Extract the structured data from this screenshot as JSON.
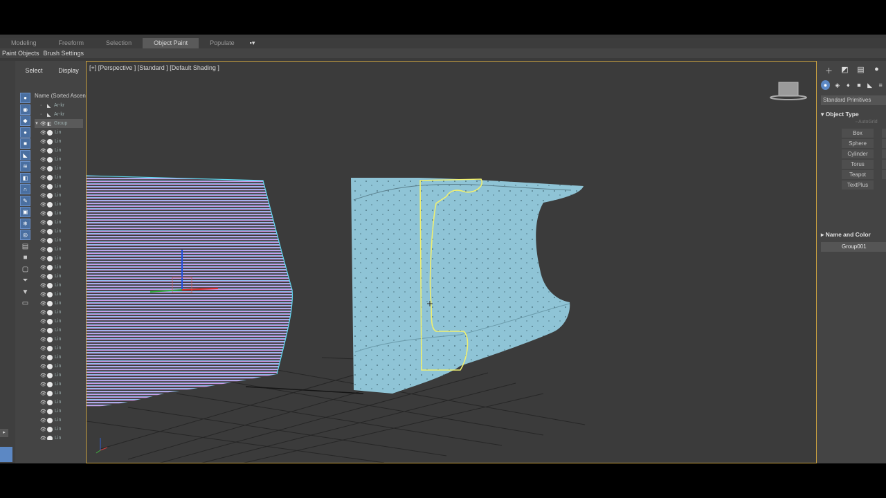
{
  "ribbon": {
    "tabs": [
      "Modeling",
      "Freeform",
      "Selection",
      "Object Paint",
      "Populate"
    ],
    "active_tab": "Object Paint",
    "sub_items": [
      "Paint Objects",
      "Brush Settings"
    ]
  },
  "scene_explorer": {
    "tabs": [
      "Select",
      "Display"
    ],
    "column_header": "Name (Sorted Ascen",
    "items": [
      {
        "label": "Ar-kr",
        "type": "helper"
      },
      {
        "label": "Ar-kr",
        "type": "helper"
      },
      {
        "label": "Group",
        "type": "group"
      },
      {
        "label": "Lin",
        "type": "line"
      }
    ]
  },
  "viewport": {
    "label": "[+] [Perspective ] [Standard ] [Default Shading ]"
  },
  "command_panel": {
    "category_dropdown": "Standard Primitives",
    "rollout_object_type": "Object Type",
    "autogrid_label": "AutoGrid",
    "buttons": [
      "Box",
      "Sphere",
      "Cylinder",
      "Torus",
      "Teapot",
      "TextPlus"
    ],
    "rollout_name_color": "Name and Color",
    "object_name": "Group001"
  },
  "colors": {
    "viewport_bg": "#3b3b3b",
    "active_border": "#c8a040",
    "mesh_fill": "#8fc4d6",
    "selection_outline": "#f0f070",
    "lines_pink": "#d49ae8",
    "lines_cyan": "#5fd8f0"
  }
}
